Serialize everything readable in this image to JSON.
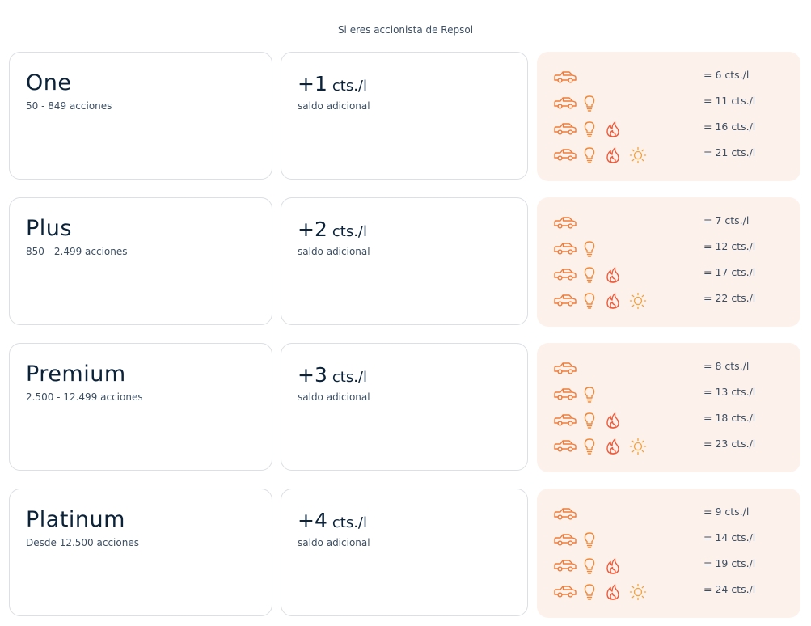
{
  "header": "Si eres accionista de Repsol",
  "tiers": [
    {
      "name": "One",
      "range": "50 - 849 acciones",
      "bonus_value": "+1",
      "bonus_unit": "cts./l",
      "bonus_sub": "saldo adicional",
      "combos": [
        {
          "icons": [
            "car-icon"
          ],
          "value": "= 6 cts./l"
        },
        {
          "icons": [
            "car-icon",
            "lightbulb-icon"
          ],
          "value": "= 11 cts./l"
        },
        {
          "icons": [
            "car-icon",
            "lightbulb-icon",
            "flame-icon"
          ],
          "value": "= 16 cts./l"
        },
        {
          "icons": [
            "car-icon",
            "lightbulb-icon",
            "flame-icon",
            "sun-icon"
          ],
          "value": "= 21 cts./l"
        }
      ]
    },
    {
      "name": "Plus",
      "range": "850 - 2.499 acciones",
      "bonus_value": "+2",
      "bonus_unit": "cts./l",
      "bonus_sub": "saldo adicional",
      "combos": [
        {
          "icons": [
            "car-icon"
          ],
          "value": "= 7 cts./l"
        },
        {
          "icons": [
            "car-icon",
            "lightbulb-icon"
          ],
          "value": "= 12 cts./l"
        },
        {
          "icons": [
            "car-icon",
            "lightbulb-icon",
            "flame-icon"
          ],
          "value": "= 17 cts./l"
        },
        {
          "icons": [
            "car-icon",
            "lightbulb-icon",
            "flame-icon",
            "sun-icon"
          ],
          "value": "= 22 cts./l"
        }
      ]
    },
    {
      "name": "Premium",
      "range": "2.500 - 12.499 acciones",
      "bonus_value": "+3",
      "bonus_unit": "cts./l",
      "bonus_sub": "saldo adicional",
      "combos": [
        {
          "icons": [
            "car-icon"
          ],
          "value": "= 8 cts./l"
        },
        {
          "icons": [
            "car-icon",
            "lightbulb-icon"
          ],
          "value": "= 13 cts./l"
        },
        {
          "icons": [
            "car-icon",
            "lightbulb-icon",
            "flame-icon"
          ],
          "value": "= 18 cts./l"
        },
        {
          "icons": [
            "car-icon",
            "lightbulb-icon",
            "flame-icon",
            "sun-icon"
          ],
          "value": "= 23 cts./l"
        }
      ]
    },
    {
      "name": "Platinum",
      "range": "Desde 12.500 acciones",
      "bonus_value": "+4",
      "bonus_unit": "cts./l",
      "bonus_sub": "saldo adicional",
      "combos": [
        {
          "icons": [
            "car-icon"
          ],
          "value": "= 9 cts./l"
        },
        {
          "icons": [
            "car-icon",
            "lightbulb-icon"
          ],
          "value": "= 14 cts./l"
        },
        {
          "icons": [
            "car-icon",
            "lightbulb-icon",
            "flame-icon"
          ],
          "value": "= 19 cts./l"
        },
        {
          "icons": [
            "car-icon",
            "lightbulb-icon",
            "flame-icon",
            "sun-icon"
          ],
          "value": "= 24 cts./l"
        }
      ]
    }
  ],
  "colors": {
    "car": "#f07c3a",
    "lightbulb": "#f08a3a",
    "flame": "#ee5a3a",
    "sun": "#f3a23c",
    "panel_bg": "#fdf1ec"
  }
}
